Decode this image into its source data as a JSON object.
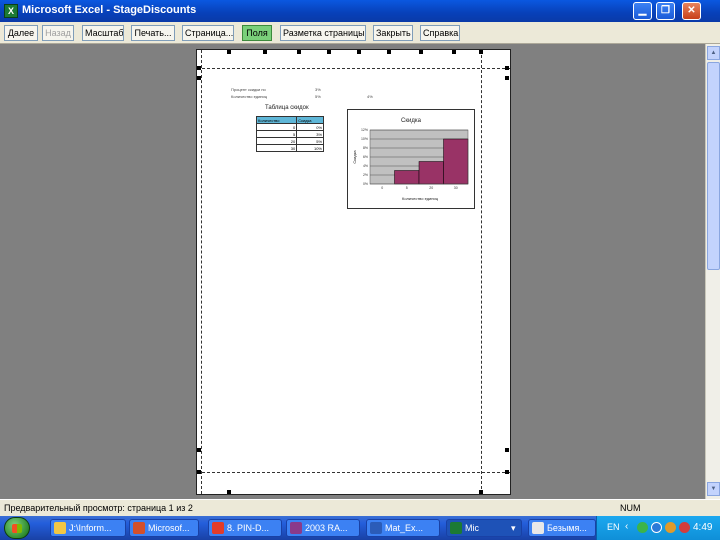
{
  "window": {
    "title": "Microsoft Excel - StageDiscounts",
    "app_icon_letter": "X"
  },
  "toolbar": {
    "buttons": [
      {
        "label": "Далее",
        "state": "normal"
      },
      {
        "label": "Назад",
        "state": "disabled"
      },
      {
        "label": "Масштаб",
        "state": "normal"
      },
      {
        "label": "Печать...",
        "state": "normal"
      },
      {
        "label": "Страница...",
        "state": "normal"
      },
      {
        "label": "Поля",
        "state": "active"
      },
      {
        "label": "Разметка страницы",
        "state": "normal"
      },
      {
        "label": "Закрыть",
        "state": "normal"
      },
      {
        "label": "Справка",
        "state": "normal"
      }
    ]
  },
  "preview": {
    "sheet_lines": [
      {
        "label": "Процент скидки по",
        "value": "3%"
      },
      {
        "label": "Количество единиц",
        "value": "5%"
      }
    ],
    "side_value": "4%",
    "table_title": "Таблица скидок",
    "table_headers": [
      "Количество",
      "Скидка"
    ],
    "table_rows": [
      [
        "0",
        "0%"
      ],
      [
        "5",
        "3%"
      ],
      [
        "20",
        "5%"
      ],
      [
        "30",
        "10%"
      ]
    ],
    "chart_data": {
      "type": "bar",
      "title": "Скидка",
      "ylabel": "Скидка",
      "xlabel": "Количество единиц",
      "categories": [
        "0",
        "5",
        "20",
        "30"
      ],
      "values": [
        0,
        3,
        5,
        10
      ],
      "ylim": [
        0,
        12
      ],
      "grid": true,
      "bar_color": "#993366",
      "plot_bg": "#c0c0c0"
    }
  },
  "status": {
    "text": "Предварительный просмотр: страница 1 из 2",
    "indicator": "NUM"
  },
  "taskbar": {
    "tasks": [
      {
        "label": "J:\\Inform...",
        "icon_color": "#f2c744"
      },
      {
        "label": "Microsof...",
        "icon_color": "#d4502a"
      },
      {
        "label": "8. PIN-D...",
        "icon_color": "#e23c2a"
      },
      {
        "label": "2003 RA...",
        "icon_color": "#8a3a8a"
      },
      {
        "label": "Mat_Ex...",
        "icon_color": "#2b5cb8"
      },
      {
        "label": "Mic",
        "icon_color": "#1c7a34"
      },
      {
        "label": "Безымя...",
        "icon_color": "#e8e8e8"
      }
    ],
    "language": "EN",
    "clock": "4:49"
  }
}
